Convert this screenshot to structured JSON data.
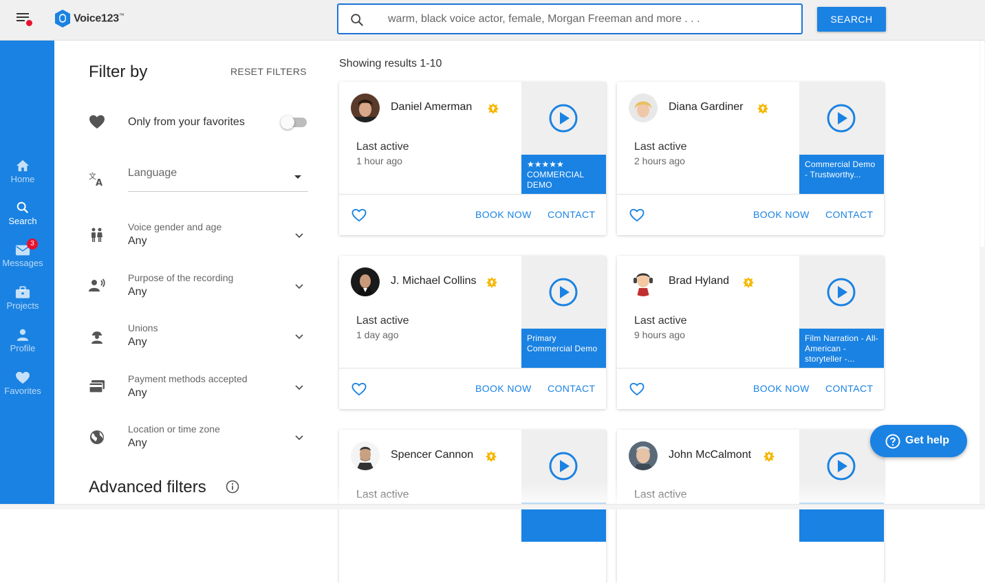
{
  "header": {
    "logo_text": "Voice123",
    "logo_tm": "™",
    "search_placeholder": "warm, black voice actor, female, Morgan Freeman and more . . .",
    "search_button": "SEARCH"
  },
  "sidenav": {
    "items": [
      {
        "label": "Home",
        "icon": "home-icon"
      },
      {
        "label": "Search",
        "icon": "search-icon"
      },
      {
        "label": "Messages",
        "icon": "mail-icon",
        "badge": "3"
      },
      {
        "label": "Projects",
        "icon": "briefcase-icon"
      },
      {
        "label": "Profile",
        "icon": "person-icon"
      },
      {
        "label": "Favorites",
        "icon": "heart-icon"
      }
    ]
  },
  "filters": {
    "title": "Filter by",
    "reset": "RESET FILTERS",
    "favorites_label": "Only from your favorites",
    "language_placeholder": "Language",
    "groups": [
      {
        "label": "Voice gender and age",
        "value": "Any"
      },
      {
        "label": "Purpose of the recording",
        "value": "Any"
      },
      {
        "label": "Unions",
        "value": "Any"
      },
      {
        "label": "Payment methods accepted",
        "value": "Any"
      },
      {
        "label": "Location or time zone",
        "value": "Any"
      }
    ],
    "advanced": "Advanced filters"
  },
  "results": {
    "title": "Showing results 1-10",
    "book_label": "BOOK NOW",
    "contact_label": "CONTACT",
    "last_active_label": "Last active",
    "cards": [
      {
        "name": "Daniel Amerman",
        "last_active": "1 hour ago",
        "stars": "★★★★★",
        "demo": "COMMERCIAL DEMO"
      },
      {
        "name": "Diana Gardiner",
        "last_active": "2 hours ago",
        "stars": "",
        "demo": "Commercial Demo - Trustworthy..."
      },
      {
        "name": "J. Michael Collins",
        "last_active": "1 day ago",
        "stars": "",
        "demo": "Primary Commercial Demo"
      },
      {
        "name": "Brad Hyland",
        "last_active": "9 hours ago",
        "stars": "",
        "demo": "Film Narration - All-American - storyteller -..."
      },
      {
        "name": "Spencer Cannon",
        "last_active": "",
        "stars": "",
        "demo": ""
      },
      {
        "name": "John McCalmont",
        "last_active": "",
        "stars": "",
        "demo": ""
      }
    ]
  },
  "help": {
    "label": "Get help"
  },
  "colors": {
    "accent": "#1a82e2",
    "badge": "#e8112d",
    "pro_badge": "#f5b800"
  }
}
